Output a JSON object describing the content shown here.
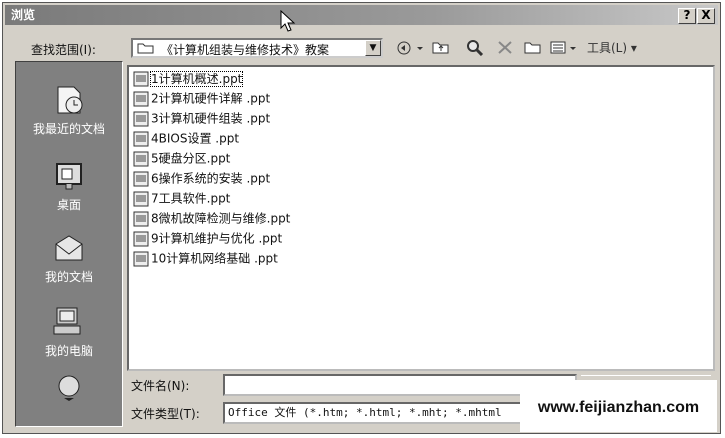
{
  "window": {
    "title": "浏览",
    "help_btn": "?",
    "close_btn": "X"
  },
  "toolbar": {
    "look_in_label": "查找范围(I):",
    "look_in_value": "《计算机组装与维修技术》教案",
    "tools_label": "工具(L)"
  },
  "places": [
    {
      "label": "我最近的文档",
      "icon": "recent-documents-icon"
    },
    {
      "label": "桌面",
      "icon": "desktop-icon"
    },
    {
      "label": "我的文档",
      "icon": "my-documents-icon"
    },
    {
      "label": "我的电脑",
      "icon": "my-computer-icon"
    },
    {
      "label": "",
      "icon": "network-places-icon"
    }
  ],
  "files": [
    "1计算机概述.ppt",
    "2计算机硬件详解 .ppt",
    "3计算机硬件组装 .ppt",
    "4BIOS设置 .ppt",
    "5硬盘分区.ppt",
    "6操作系统的安装 .ppt",
    "7工具软件.ppt",
    "8微机故障检测与维修.ppt",
    "9计算机维护与优化 .ppt",
    "10计算机网络基础 .ppt"
  ],
  "filename": {
    "label": "文件名(N):",
    "value": ""
  },
  "filetype": {
    "label": "文件类型(T):",
    "value": "Office 文件 (*.htm; *.html; *.mht; *.mhtml"
  },
  "watermark": "www.feijianzhan.com"
}
